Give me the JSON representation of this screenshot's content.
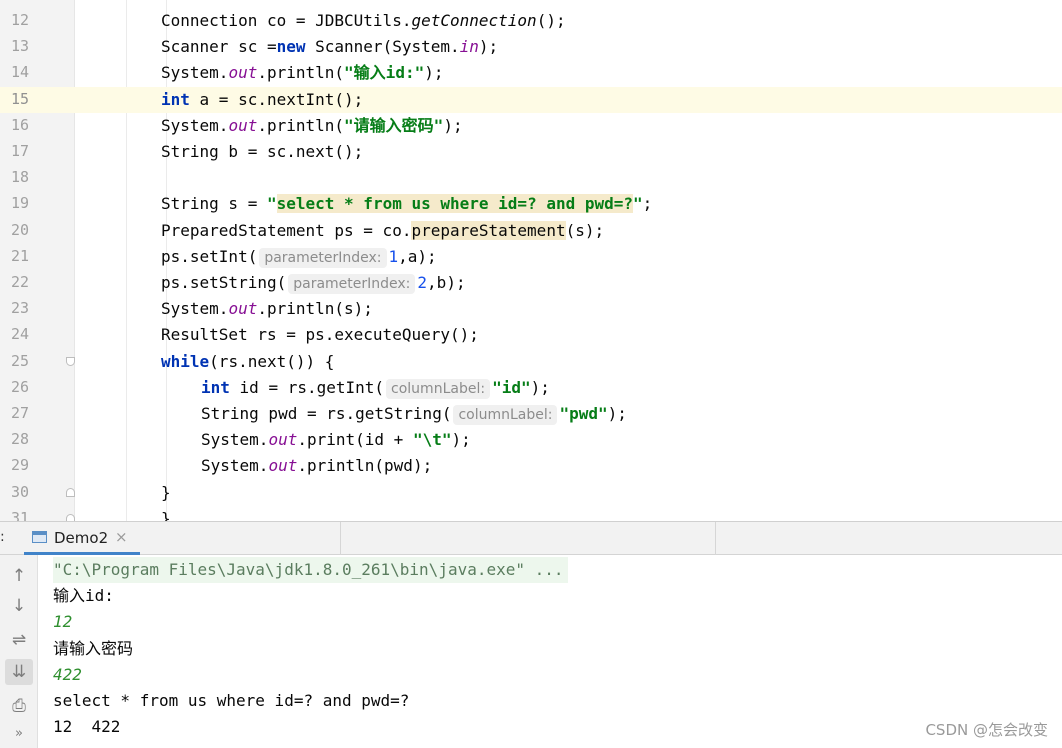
{
  "editor": {
    "lines": [
      {
        "n": "12",
        "html": "Connection co = JDBCUtils.<span class=\"ital\">getConnection</span>();"
      },
      {
        "n": "13",
        "html": "Scanner sc =<span class=\"kw\">new</span> Scanner(System.<span class=\"stat\">in</span>);"
      },
      {
        "n": "14",
        "html": "System.<span class=\"stat\">out</span>.println(<span class=\"str\">\"输入id:\"</span>);"
      },
      {
        "n": "15",
        "html": "<span class=\"kw\">int</span> a = sc.nextInt();",
        "current": true
      },
      {
        "n": "16",
        "html": "System.<span class=\"stat\">out</span>.println(<span class=\"str\">\"请输入密码\"</span>);"
      },
      {
        "n": "17",
        "html": "String b = sc.next();"
      },
      {
        "n": "18",
        "html": ""
      },
      {
        "n": "19",
        "html": "String s = <span class=\"str\">\"</span><span class=\"str hl\">select * from us where id=? and pwd=?</span><span class=\"str\">\"</span>;"
      },
      {
        "n": "20",
        "html": "PreparedStatement ps = co.<span class=\"hl\">prepareStatement</span>(s);"
      },
      {
        "n": "21",
        "html": "ps.setInt(<span class=\"hint\">parameterIndex:</span><span style=\"color:#1750eb\">1</span>,a);"
      },
      {
        "n": "22",
        "html": "ps.setString(<span class=\"hint\">parameterIndex:</span><span style=\"color:#1750eb\">2</span>,b);"
      },
      {
        "n": "23",
        "html": "System.<span class=\"stat\">out</span>.println(s);"
      },
      {
        "n": "24",
        "html": "ResultSet rs = ps.executeQuery();"
      },
      {
        "n": "25",
        "html": "<span class=\"kw\">while</span>(rs.next()) {",
        "fold": "start"
      },
      {
        "n": "26",
        "html": "<span class=\"kw\">int</span> id = rs.getInt(<span class=\"hint\">columnLabel:</span><span class=\"str\">\"id\"</span>);",
        "indent": 2
      },
      {
        "n": "27",
        "html": "String pwd = rs.getString(<span class=\"hint\">columnLabel:</span><span class=\"str\">\"pwd\"</span>);",
        "indent": 2
      },
      {
        "n": "28",
        "html": "System.<span class=\"stat\">out</span>.print(id + <span class=\"str\">\"\\t\"</span>);",
        "indent": 2
      },
      {
        "n": "29",
        "html": "System.<span class=\"stat\">out</span>.println(pwd);",
        "indent": 2
      },
      {
        "n": "30",
        "html": "}",
        "fold": "end"
      },
      {
        "n": "31",
        "html": "}",
        "fold": "end"
      }
    ]
  },
  "run": {
    "colon": ":",
    "tab_label": "Demo2",
    "tab_close": "×",
    "tools": [
      "↑",
      "↓",
      "⇌",
      "⇊",
      "⎙",
      "»"
    ],
    "console": [
      {
        "text": "\"C:\\Program Files\\Java\\jdk1.8.0_261\\bin\\java.exe\" ...",
        "kind": "cmd"
      },
      {
        "text": "输入id:",
        "kind": "out"
      },
      {
        "text": "12",
        "kind": "input"
      },
      {
        "text": "请输入密码",
        "kind": "out"
      },
      {
        "text": "422",
        "kind": "input"
      },
      {
        "text": "select * from us where id=? and pwd=?",
        "kind": "out"
      },
      {
        "text": "12\t422",
        "kind": "out"
      }
    ]
  },
  "watermark": "CSDN @怎会改变"
}
